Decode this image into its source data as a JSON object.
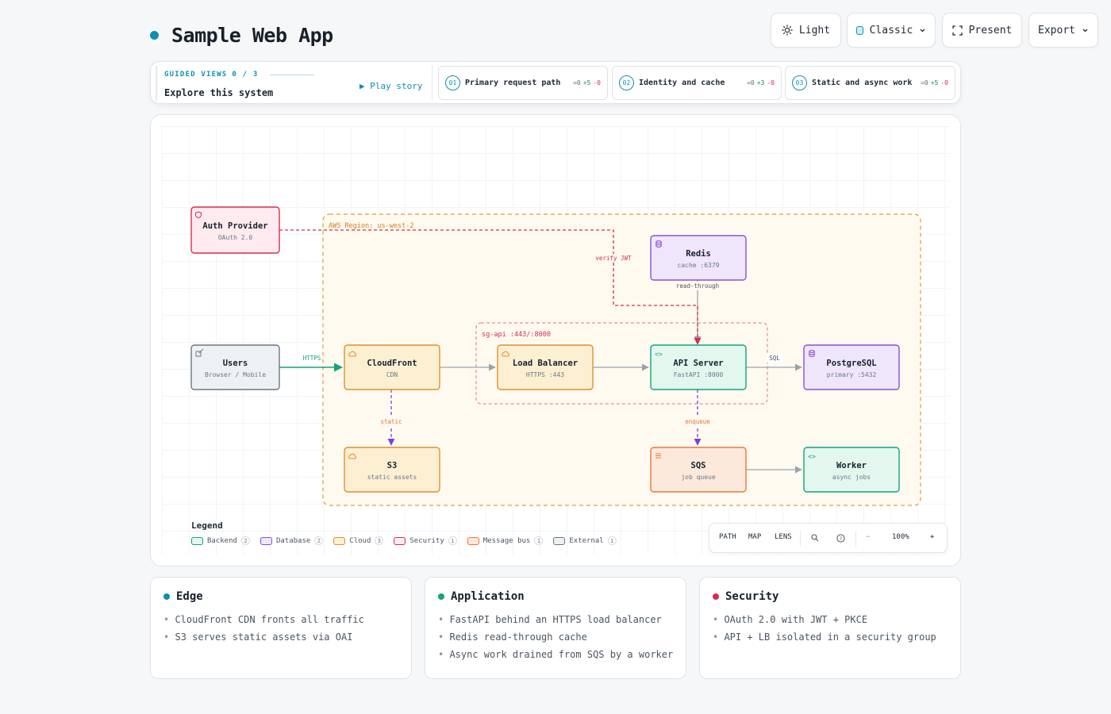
{
  "app": {
    "title": "Sample Web App"
  },
  "topbar": {
    "theme_label": "Light",
    "style_label": "Classic",
    "present_label": "Present",
    "export_label": "Export"
  },
  "guided": {
    "label": "GUIDED VIEWS",
    "progress": "0 / 3",
    "subtitle": "Explore this system",
    "play_label": "▶ Play story",
    "steps": [
      {
        "num": "01",
        "label": "Primary request path",
        "eq": "=0",
        "plus": "+5",
        "minus": "-0"
      },
      {
        "num": "02",
        "label": "Identity and cache",
        "eq": "=0",
        "plus": "+3",
        "minus": "-0"
      },
      {
        "num": "03",
        "label": "Static and async work",
        "eq": "=0",
        "plus": "+5",
        "minus": "-0"
      }
    ]
  },
  "diagram": {
    "groups": {
      "region": "AWS Region: us-west-2",
      "sg": "sg-api :443/:8000"
    },
    "nodes": {
      "auth": {
        "name": "Auth Provider",
        "sub": "OAuth 2.0",
        "kind": "Security"
      },
      "redis": {
        "name": "Redis",
        "sub": "cache :6379",
        "kind": "Database"
      },
      "users": {
        "name": "Users",
        "sub": "Browser / Mobile",
        "kind": "External"
      },
      "cloudfront": {
        "name": "CloudFront",
        "sub": "CDN",
        "kind": "Cloud"
      },
      "lb": {
        "name": "Load Balancer",
        "sub": "HTTPS :443",
        "kind": "Cloud"
      },
      "api": {
        "name": "API Server",
        "sub": "FastAPI :8000",
        "kind": "Backend"
      },
      "postgres": {
        "name": "PostgreSQL",
        "sub": "primary :5432",
        "kind": "Database"
      },
      "s3": {
        "name": "S3",
        "sub": "static assets",
        "kind": "Cloud"
      },
      "sqs": {
        "name": "SQS",
        "sub": "job queue",
        "kind": "Message bus"
      },
      "worker": {
        "name": "Worker",
        "sub": "async jobs",
        "kind": "Backend"
      }
    },
    "edges": {
      "users_cf": "HTTPS",
      "auth_api": "verify JWT",
      "redis_api": "read-through",
      "api_pg": "SQL",
      "cf_s3": "static",
      "api_sqs": "enqueue"
    },
    "colors": {
      "backend": "#12a47a",
      "database": "#8b4fd6",
      "cloud": "#e0902a",
      "security": "#d62d4f",
      "message_bus": "#e8773a",
      "external": "#6b7785"
    }
  },
  "legend": {
    "title": "Legend",
    "items": [
      {
        "label": "Backend",
        "count": "2"
      },
      {
        "label": "Database",
        "count": "2"
      },
      {
        "label": "Cloud",
        "count": "3"
      },
      {
        "label": "Security",
        "count": "1"
      },
      {
        "label": "Message bus",
        "count": "1"
      },
      {
        "label": "External",
        "count": "1"
      }
    ]
  },
  "toolbar": {
    "path": "PATH",
    "map": "MAP",
    "lens": "LENS",
    "zoom_out": "−",
    "zoom": "100%",
    "zoom_in": "+"
  },
  "cards": [
    {
      "title": "Edge",
      "color": "#0e8fb0",
      "items": [
        "CloudFront CDN fronts all traffic",
        "S3 serves static assets via OAI"
      ]
    },
    {
      "title": "Application",
      "color": "#12a47a",
      "items": [
        "FastAPI behind an HTTPS load balancer",
        "Redis read-through cache",
        "Async work drained from SQS by a worker"
      ]
    },
    {
      "title": "Security",
      "color": "#d62d4f",
      "items": [
        "OAuth 2.0 with JWT + PKCE",
        "API + LB isolated in a security group"
      ]
    }
  ]
}
